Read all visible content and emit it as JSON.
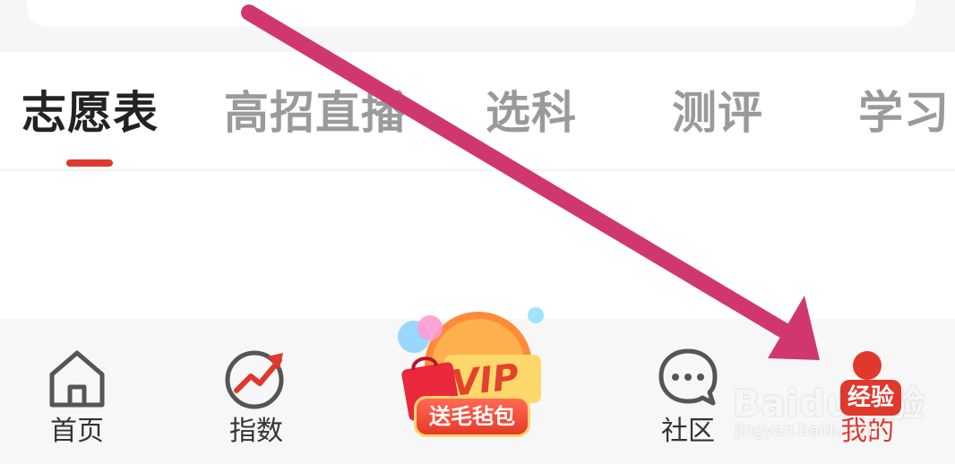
{
  "tabs": {
    "items": [
      {
        "label": "志愿表",
        "active": true
      },
      {
        "label": "高招直播",
        "active": false
      },
      {
        "label": "选科",
        "active": false
      },
      {
        "label": "测评",
        "active": false
      },
      {
        "label": "学习",
        "active": false
      }
    ]
  },
  "bottom_nav": {
    "items": [
      {
        "label": "首页",
        "icon": "home-icon"
      },
      {
        "label": "指数",
        "icon": "trend-chart-icon"
      },
      {
        "label": "社区",
        "icon": "chat-bubble-icon"
      },
      {
        "label": "我的",
        "icon": "user-icon"
      }
    ],
    "vip_promo": {
      "vip_text": "VIP",
      "button_label": "送毛毡包"
    }
  },
  "watermark": {
    "brand": "Baidu经验",
    "badge": "经验",
    "url": "jingyan.baidu.com"
  },
  "colors": {
    "accent": "#e0382c",
    "annotation_arrow": "#d1376f",
    "inactive_text": "#9a9a9a",
    "active_text": "#222222"
  }
}
